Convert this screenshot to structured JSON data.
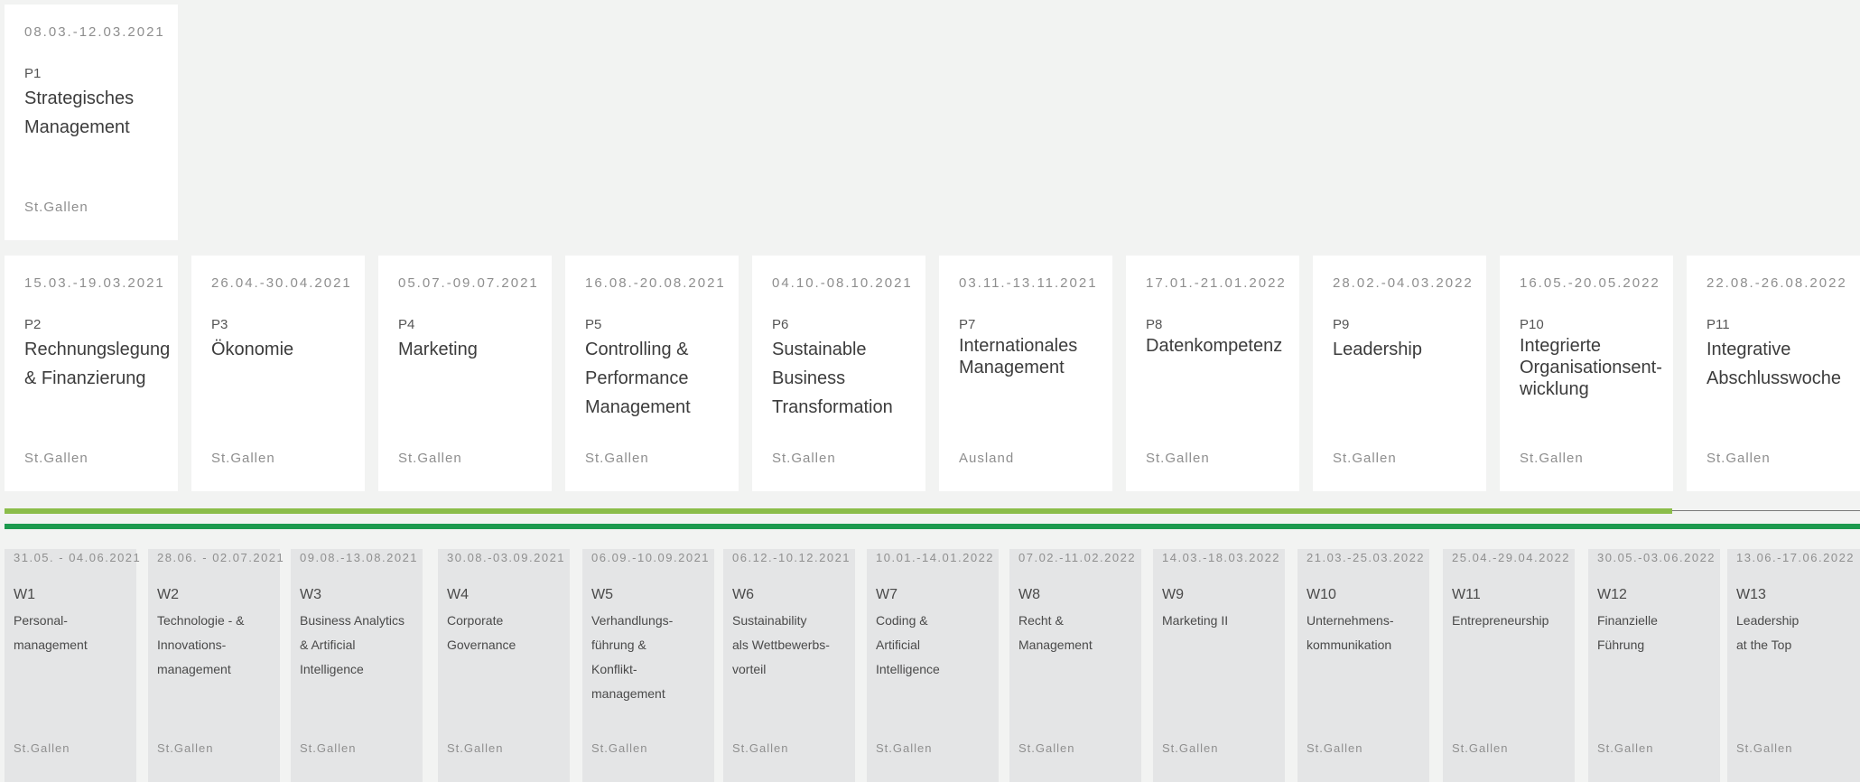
{
  "presence_modules": [
    {
      "date": "08.03.-12.03.2021",
      "code": "P1",
      "title": "Strategisches\nManagement",
      "location": "St.Gallen"
    },
    {
      "date": "15.03.-19.03.2021",
      "code": "P2",
      "title": "Rechnungslegung\n& Finanzierung",
      "location": "St.Gallen"
    },
    {
      "date": "26.04.-30.04.2021",
      "code": "P3",
      "title": "Ökonomie",
      "location": "St.Gallen"
    },
    {
      "date": "05.07.-09.07.2021",
      "code": "P4",
      "title": "Marketing",
      "location": "St.Gallen"
    },
    {
      "date": "16.08.-20.08.2021",
      "code": "P5",
      "title": "Controlling &\nPerformance\nManagement",
      "location": "St.Gallen"
    },
    {
      "date": "04.10.-08.10.2021",
      "code": "P6",
      "title": "Sustainable\nBusiness\nTransformation",
      "location": "St.Gallen"
    },
    {
      "date": "03.11.-13.11.2021",
      "code": "P7",
      "title": "Internationales\nManagement",
      "location": "Ausland"
    },
    {
      "date": "17.01.-21.01.2022",
      "code": "P8",
      "title": "Datenkompetenz",
      "location": "St.Gallen"
    },
    {
      "date": "28.02.-04.03.2022",
      "code": "P9",
      "title": "Leadership",
      "location": "St.Gallen"
    },
    {
      "date": "16.05.-20.05.2022",
      "code": "P10",
      "title": "Integrierte\nOrganisationsent-\nwicklung",
      "location": "St.Gallen"
    },
    {
      "date": "22.08.-26.08.2022",
      "code": "P11",
      "title": "Integrative\nAbschlusswoche",
      "location": "St.Gallen"
    }
  ],
  "weekly_modules": [
    {
      "date": "31.05. - 04.06.2021",
      "code": "W1",
      "title": "Personal-\nmanagement",
      "location": "St.Gallen"
    },
    {
      "date": "28.06. - 02.07.2021",
      "code": "W2",
      "title": "Technologie - &\nInnovations-\nmanagement",
      "location": "St.Gallen"
    },
    {
      "date": "09.08.-13.08.2021",
      "code": "W3",
      "title": "Business Analytics\n& Artificial\nIntelligence",
      "location": "St.Gallen"
    },
    {
      "date": "30.08.-03.09.2021",
      "code": "W4",
      "title": "Corporate\nGovernance",
      "location": "St.Gallen"
    },
    {
      "date": "06.09.-10.09.2021",
      "code": "W5",
      "title": "Verhandlungs-\nführung &\nKonflikt-\nmanagement",
      "location": "St.Gallen"
    },
    {
      "date": "06.12.-10.12.2021",
      "code": "W6",
      "title": "Sustainability\nals Wettbewerbs-\nvorteil",
      "location": "St.Gallen"
    },
    {
      "date": "10.01.-14.01.2022",
      "code": "W7",
      "title": "Coding &\nArtificial\nIntelligence",
      "location": "St.Gallen"
    },
    {
      "date": "07.02.-11.02.2022",
      "code": "W8",
      "title": "Recht &\nManagement",
      "location": "St.Gallen"
    },
    {
      "date": "14.03.-18.03.2022",
      "code": "W9",
      "title": "Marketing II",
      "location": "St.Gallen"
    },
    {
      "date": "21.03.-25.03.2022",
      "code": "W10",
      "title": "Unternehmens-\nkommunikation",
      "location": "St.Gallen"
    },
    {
      "date": "25.04.-29.04.2022",
      "code": "W11",
      "title": "Entrepreneurship",
      "location": "St.Gallen"
    },
    {
      "date": "30.05.-03.06.2022",
      "code": "W12",
      "title": "Finanzielle\nFührung",
      "location": "St.Gallen"
    },
    {
      "date": "13.06.-17.06.2022",
      "code": "W13",
      "title": "Leadership\nat the Top",
      "location": "St.Gallen"
    }
  ],
  "colors": {
    "line_light": "#8bbd4a",
    "line_dark": "#1d9a4e",
    "weekly_bg": "#e4e5e6"
  }
}
